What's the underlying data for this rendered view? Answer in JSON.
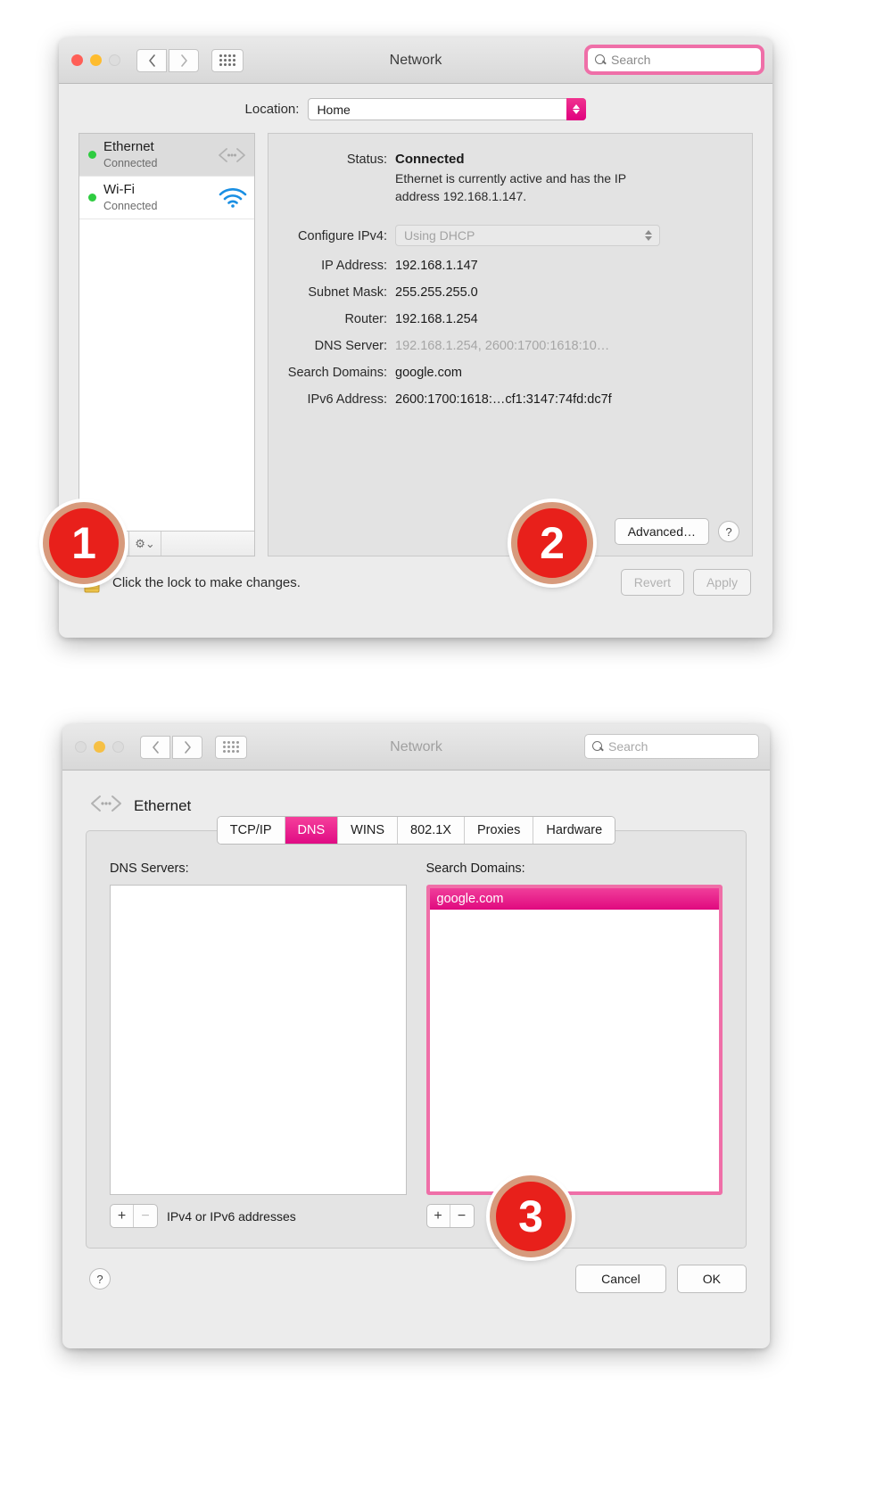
{
  "window_main": {
    "title": "Network",
    "search": {
      "placeholder": "Search",
      "icon": "search-icon"
    },
    "location": {
      "label": "Location:",
      "value": "Home"
    },
    "services": [
      {
        "name": "Ethernet",
        "status": "Connected",
        "icon": "ethernet-icon",
        "selected": true
      },
      {
        "name": "Wi-Fi",
        "status": "Connected",
        "icon": "wifi-icon",
        "selected": false
      }
    ],
    "sidebar_tools": {
      "add": "+",
      "remove": "−",
      "gear": "gear-icon",
      "gear_chevron": "⌄"
    },
    "details": {
      "status_label": "Status:",
      "status_value": "Connected",
      "status_help": "Ethernet is currently active and has the IP address 192.168.1.147.",
      "configure_label": "Configure IPv4:",
      "configure_value": "Using DHCP",
      "rows": [
        {
          "label": "IP Address:",
          "value": "192.168.1.147",
          "muted": false
        },
        {
          "label": "Subnet Mask:",
          "value": "255.255.255.0",
          "muted": false
        },
        {
          "label": "Router:",
          "value": "192.168.1.254",
          "muted": false
        },
        {
          "label": "DNS Server:",
          "value": "192.168.1.254, 2600:1700:1618:10…",
          "muted": true
        },
        {
          "label": "Search Domains:",
          "value": "google.com",
          "muted": false
        },
        {
          "label": "IPv6 Address:",
          "value": "2600:1700:1618:…cf1:3147:74fd:dc7f",
          "muted": false
        }
      ],
      "advanced_button": "Advanced…",
      "help_button": "?"
    },
    "lock": {
      "text": "Click the lock to make changes.",
      "icon": "lock-icon"
    },
    "revert_button": "Revert",
    "apply_button": "Apply"
  },
  "window_dns": {
    "title": "Network",
    "search": {
      "placeholder": "Search",
      "icon": "search-icon"
    },
    "interface": {
      "name": "Ethernet",
      "icon": "ethernet-icon"
    },
    "tabs": [
      {
        "label": "TCP/IP",
        "active": false
      },
      {
        "label": "DNS",
        "active": true
      },
      {
        "label": "WINS",
        "active": false
      },
      {
        "label": "802.1X",
        "active": false
      },
      {
        "label": "Proxies",
        "active": false
      },
      {
        "label": "Hardware",
        "active": false
      }
    ],
    "dns_servers": {
      "title": "DNS Servers:",
      "entries": [],
      "add": "+",
      "remove": "−",
      "note": "IPv4 or IPv6 addresses"
    },
    "search_domains": {
      "title": "Search Domains:",
      "entries": [
        "google.com"
      ],
      "add": "+",
      "remove": "−"
    },
    "help_button": "?",
    "cancel_button": "Cancel",
    "ok_button": "OK"
  },
  "callouts": [
    {
      "number": "1"
    },
    {
      "number": "2"
    },
    {
      "number": "3"
    }
  ],
  "colors": {
    "accent_pink": "#e0077f",
    "highlight_pink": "#ef6fa8",
    "status_green": "#2ecc40",
    "badge_red": "#e8201b",
    "badge_ring": "#d79a7c"
  }
}
